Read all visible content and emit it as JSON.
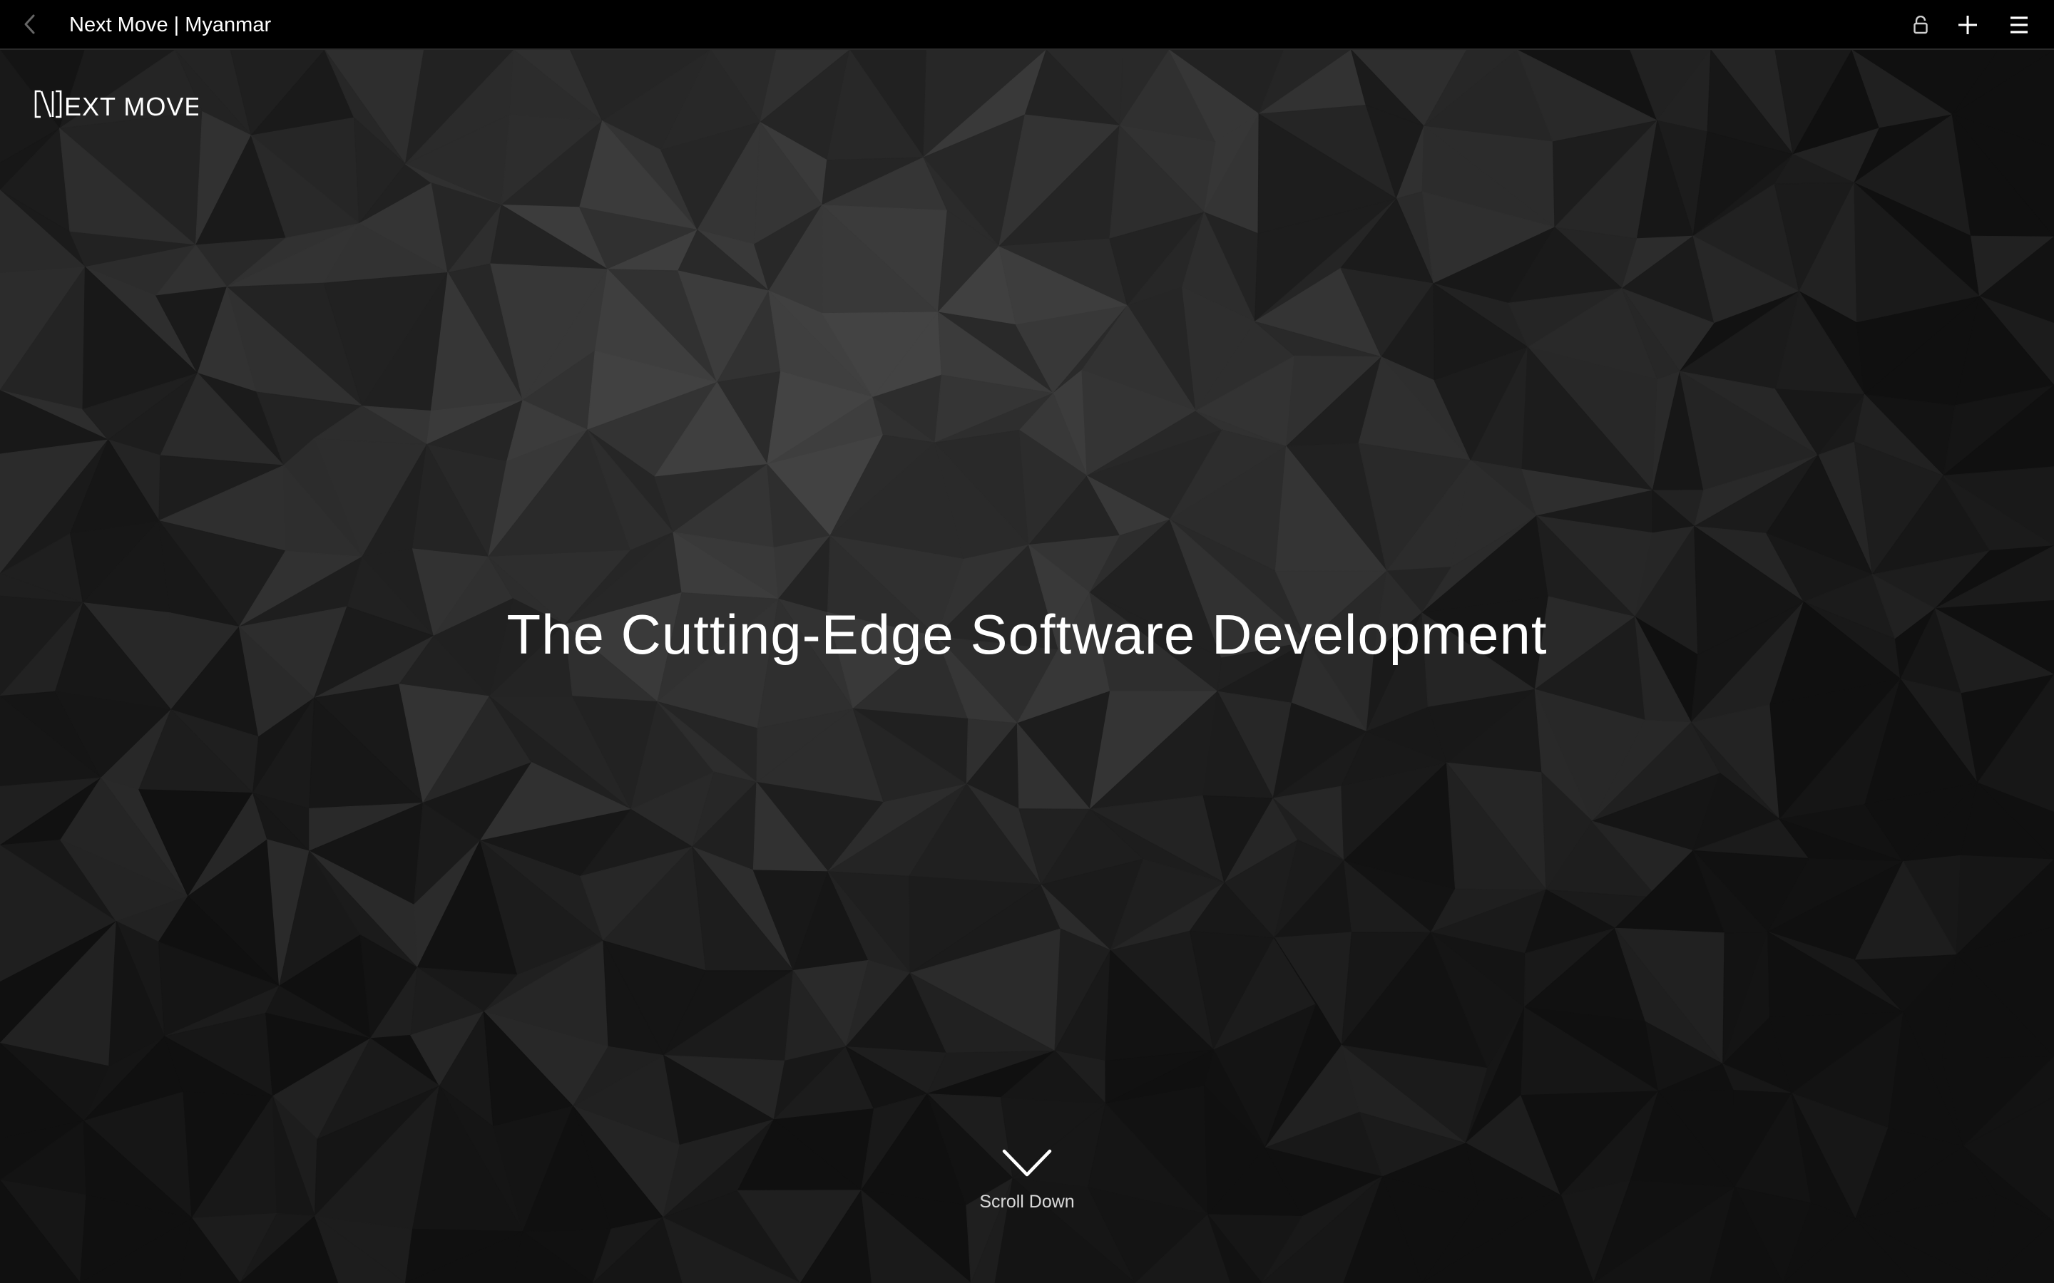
{
  "browser": {
    "title": "Next Move | Myanmar",
    "icons": [
      "chevron-left-icon",
      "lock-icon",
      "plus-icon",
      "menu-icon"
    ]
  },
  "hero": {
    "logo_text": "[\\]EXT MOVE",
    "headline": "The Cutting-Edge Software Development",
    "scroll_label": "Scroll Down"
  },
  "colors": {
    "bar_background": "#000000",
    "hero_background": "#151515",
    "text": "#ffffff"
  }
}
